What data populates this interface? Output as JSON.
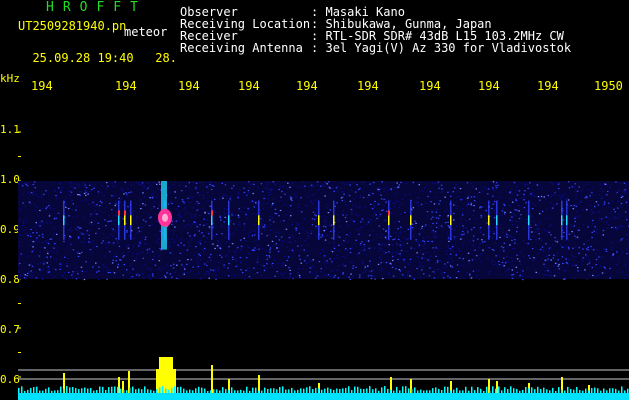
{
  "header": {
    "app_title": "HROFFT",
    "filename": "UT2509281940.pn",
    "detection_label": "meteor",
    "datetime": "25.09.28 19:40",
    "datetime_suffix": "28.",
    "fields": [
      {
        "label": "Observer",
        "sep": ":",
        "value": "Masaki Kano"
      },
      {
        "label": "Receiving Location",
        "sep": ":",
        "value": "Shibukawa, Gunma, Japan"
      },
      {
        "label": "Receiver",
        "sep": ":",
        "value": "RTL-SDR SDR# 43dB L15 103.2MHz CW"
      },
      {
        "label": "Receiving Antenna",
        "sep": ":",
        "value": "3el Yagi(V) Az 330 for Vladivostok"
      }
    ]
  },
  "chart_data": {
    "type": "heatmap",
    "xlabel": "",
    "ylabel": "kHz",
    "x_tick_labels": [
      "194",
      "194",
      "194",
      "194",
      "194",
      "194",
      "194",
      "194",
      "194",
      "1950"
    ],
    "y_tick_labels": [
      "1.1",
      "1.0",
      "0.9",
      "0.8",
      "0.7",
      "0.6"
    ],
    "ylim": [
      0.58,
      1.15
    ],
    "signal_band_khz": [
      0.8,
      1.0
    ],
    "meteor_echo": {
      "freq_khz": 0.925,
      "color": "#ff3399"
    },
    "colors": {
      "background": "#000000",
      "noise_low": "#0a0a88",
      "noise_mid": "#3344ff",
      "echo_cyan": "#22ddff",
      "echo_yellow": "#ffff00",
      "echo_red": "#ff3333",
      "baseline": "#00ffff",
      "reference_line": "#c8c8c8",
      "bars": "#ffff00"
    }
  }
}
